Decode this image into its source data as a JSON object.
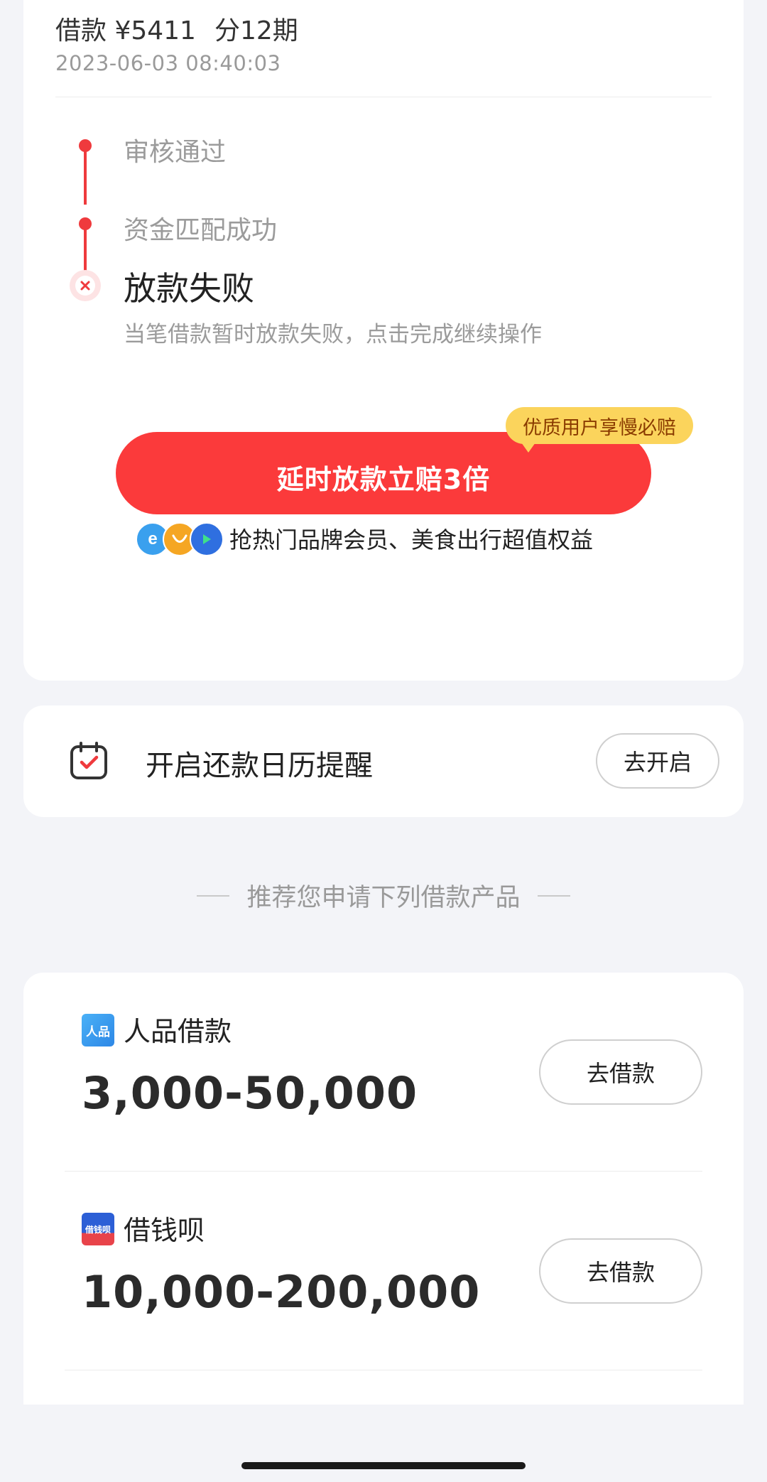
{
  "loan": {
    "title_amount": "借款 ¥5411",
    "title_term": "分12期",
    "time": "2023-06-03 08:40:03"
  },
  "timeline": {
    "step1": "审核通过",
    "step2": "资金匹配成功",
    "current": "放款失败",
    "current_desc": "当笔借款暂时放款失败，点击完成继续操作"
  },
  "promo": {
    "badge": "优质用户享慢必赔",
    "button": "延时放款立赔3倍",
    "benefit_text": "抢热门品牌会员、美食出行超值权益",
    "benefit_icons": [
      "e-browser-icon",
      "food-app-icon",
      "video-play-icon"
    ]
  },
  "reminder": {
    "text": "开启还款日历提醒",
    "button": "去开启"
  },
  "recommend": {
    "header": "推荐您申请下列借款产品",
    "products": [
      {
        "logo": "人品",
        "name": "人品借款",
        "range": "3,000-50,000",
        "button": "去借款"
      },
      {
        "logo": "借钱呗",
        "name": "借钱呗",
        "range": "10,000-200,000",
        "button": "去借款"
      }
    ]
  },
  "colors": {
    "accent_red": "#fb3a3b",
    "badge_yellow": "#fbd45c",
    "background": "#f3f4f8"
  }
}
